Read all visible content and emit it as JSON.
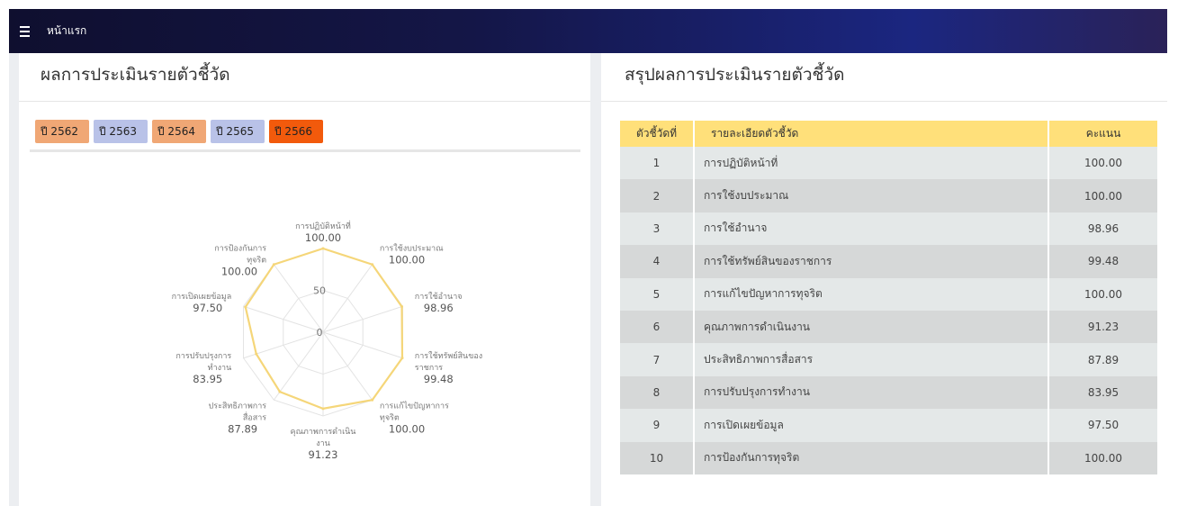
{
  "topbar": {
    "menu_icon": "hamburger-icon",
    "home_label": "หน้าแรก"
  },
  "left_panel": {
    "title": "ผลการประเมินรายตัวชี้วัด",
    "years": [
      {
        "label": "ปี 2562",
        "color": "#f0a775",
        "active": false
      },
      {
        "label": "ปี 2563",
        "color": "#b9c2e8",
        "active": false
      },
      {
        "label": "ปี 2564",
        "color": "#f0a775",
        "active": false
      },
      {
        "label": "ปี 2565",
        "color": "#b9c2e8",
        "active": false
      },
      {
        "label": "ปี 2566",
        "color": "#f25a0c",
        "active": true
      }
    ]
  },
  "chart_data": {
    "type": "radar",
    "rlim": [
      0,
      100
    ],
    "ticks": [
      "0",
      "50",
      "100.00"
    ],
    "line_color": "#f5d679",
    "categories": [
      "การปฏิบัติหน้าที่",
      "การใช้งบประมาณ",
      "การใช้อำนาจ",
      "การใช้ทรัพย์สินของราชการ",
      "การแก้ไขปัญหาการทุจริต",
      "คุณภาพการดำเนินงาน",
      "ประสิทธิภาพการสื่อสาร",
      "การปรับปรุงการทำงาน",
      "การเปิดเผยข้อมูล",
      "การป้องกันการทุจริต"
    ],
    "category_label_lines": [
      [
        "การปฏิบัติหน้าที่"
      ],
      [
        "การใช้งบประมาณ"
      ],
      [
        "การใช้อำนาจ"
      ],
      [
        "การใช้ทรัพย์สินของ",
        "ราชการ"
      ],
      [
        "การแก้ไขปัญหาการ",
        "ทุจริต"
      ],
      [
        "คุณภาพการดำเนิน",
        "งาน"
      ],
      [
        "ประสิทธิภาพการ",
        "สื่อสาร"
      ],
      [
        "การปรับปรุงการ",
        "ทำงาน"
      ],
      [
        "การเปิดเผยข้อมูล"
      ],
      [
        "การป้องกันการ",
        "ทุจริต"
      ]
    ],
    "values": [
      100.0,
      100.0,
      98.96,
      99.48,
      100.0,
      91.23,
      87.89,
      83.95,
      97.5,
      100.0
    ],
    "value_labels": [
      "100.00",
      "100.00",
      "98.96",
      "99.48",
      "100.00",
      "91.23",
      "87.89",
      "83.95",
      "97.50",
      "100.00"
    ]
  },
  "right_panel": {
    "title": "สรุปผลการประเมินรายตัวชี้วัด",
    "headers": [
      "ตัวชี้วัดที่",
      "รายละเอียดตัวชี้วัด",
      "คะแนน"
    ],
    "header_color": "#ffe07a",
    "rows": [
      [
        "1",
        "การปฏิบัติหน้าที่",
        "100.00"
      ],
      [
        "2",
        "การใช้งบประมาณ",
        "100.00"
      ],
      [
        "3",
        "การใช้อำนาจ",
        "98.96"
      ],
      [
        "4",
        "การใช้ทรัพย์สินของราชการ",
        "99.48"
      ],
      [
        "5",
        "การแก้ไขปัญหาการทุจริต",
        "100.00"
      ],
      [
        "6",
        "คุณภาพการดำเนินงาน",
        "91.23"
      ],
      [
        "7",
        "ประสิทธิภาพการสื่อสาร",
        "87.89"
      ],
      [
        "8",
        "การปรับปรุงการทำงาน",
        "83.95"
      ],
      [
        "9",
        "การเปิดเผยข้อมูล",
        "97.50"
      ],
      [
        "10",
        "การป้องกันการทุจริต",
        "100.00"
      ]
    ]
  }
}
